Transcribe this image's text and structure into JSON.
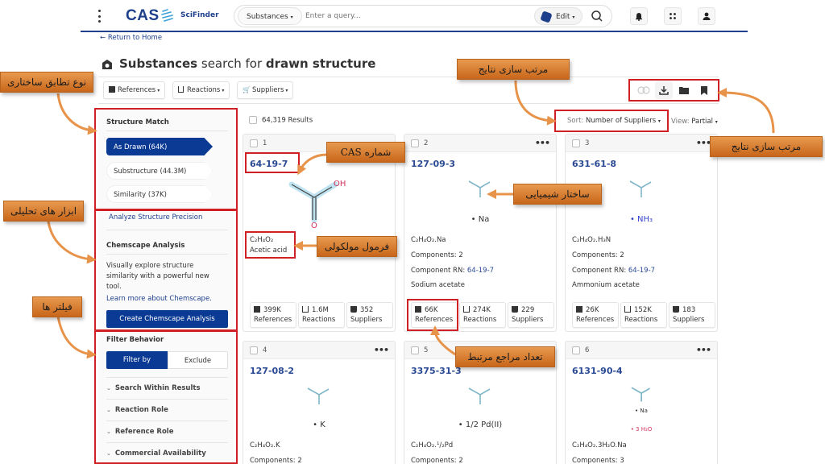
{
  "header": {
    "logo_text": "CAS",
    "logo_sub": "SciFinder",
    "search_type": "Substances",
    "search_placeholder": "Enter a query...",
    "edit_label": "Edit",
    "icons": [
      "menu-icon",
      "search-icon",
      "bell-icon",
      "apps-icon",
      "user-icon"
    ]
  },
  "nav": {
    "return_link": "← Return to Home"
  },
  "page": {
    "title_bold": "Substances",
    "title_mid": " search for ",
    "title_end": "drawn structure"
  },
  "toolbar": {
    "buttons": [
      {
        "label": "References",
        "icon": "book-icon"
      },
      {
        "label": "Reactions",
        "icon": "flask-icon"
      },
      {
        "label": "Suppliers",
        "icon": "cart-icon"
      }
    ],
    "actions": [
      "combine-icon",
      "download-icon",
      "folder-icon",
      "bookmark-icon"
    ]
  },
  "sidebar": {
    "structure_match": {
      "heading": "Structure Match",
      "items": [
        {
          "label": "As Drawn (64K)",
          "active": true
        },
        {
          "label": "Substructure (44.3M)",
          "active": false
        },
        {
          "label": "Similarity (37K)",
          "active": false
        }
      ]
    },
    "analyze_link": "Analyze Structure Precision",
    "chemscape": {
      "heading": "Chemscape Analysis",
      "description": "Visually explore structure similarity with a powerful new tool.",
      "learn_more": "Learn more about Chemscape.",
      "button": "Create Chemscape Analysis"
    },
    "filter_behavior": {
      "heading": "Filter Behavior",
      "options": [
        "Filter by",
        "Exclude"
      ],
      "selected": "Filter by"
    },
    "filters": [
      "Search Within Results",
      "Reaction Role",
      "Reference Role",
      "Commercial Availability"
    ]
  },
  "results": {
    "count_label": "64,319 Results",
    "sort_prefix": "Sort: ",
    "sort_value": "Number of Suppliers",
    "view_prefix": "View: ",
    "view_value": "Partial",
    "cards": [
      {
        "index": "1",
        "cas": "64-19-7",
        "salt": "",
        "formula": "C₂H₄O₂",
        "lines": [
          "Acetic acid"
        ],
        "references": "399K",
        "reactions": "1.6M",
        "suppliers": "352"
      },
      {
        "index": "2",
        "cas": "127-09-3",
        "salt": "• Na",
        "formula": "C₂H₄O₂.Na",
        "lines": [
          "Components: 2",
          "Component RN: ",
          "Sodium acetate"
        ],
        "component_rn": "64-19-7",
        "references": "66K",
        "reactions": "274K",
        "suppliers": "229"
      },
      {
        "index": "3",
        "cas": "631-61-8",
        "salt": "• NH₃",
        "formula": "C₂H₄O₂.H₃N",
        "lines": [
          "Components: 2",
          "Component RN: ",
          "Ammonium acetate"
        ],
        "component_rn": "64-19-7",
        "references": "26K",
        "reactions": "152K",
        "suppliers": "183"
      },
      {
        "index": "4",
        "cas": "127-08-2",
        "salt": "• K",
        "formula": "C₂H₄O₂.K",
        "lines": [
          "Components: 2"
        ]
      },
      {
        "index": "5",
        "cas": "3375-31-3",
        "salt": "• 1/2 Pd(II)",
        "formula": "C₂H₄O₂.¹/₂Pd",
        "lines": [
          "Components: 2"
        ]
      },
      {
        "index": "6",
        "cas": "6131-90-4",
        "salt": "• Na",
        "salt2": "• 3 H₂O",
        "formula": "C₂H₄O₂.3H₂O.Na",
        "lines": [
          "Components: 3"
        ]
      }
    ],
    "stat_labels": {
      "references": "References",
      "reactions": "Reactions",
      "suppliers": "Suppliers"
    },
    "structure_labels": {
      "oh": "OH",
      "o": "O"
    }
  },
  "annotations": {
    "structure_match_type": "نوع تطابق ساختاری",
    "analysis_tools": "ابزار های تحلیلی",
    "filters": "فیلتر ها",
    "sort_results_top": "مرتب سازی نتایج",
    "sort_results_right": "مرتب سازی نتایج",
    "cas_number": "شماره CAS",
    "chemical_structure": "ساختار شیمیایی",
    "molecular_formula": "فرمول مولکولی",
    "related_references": "تعداد مراجع مرتبط"
  },
  "colors": {
    "brand": "#1d3f8c",
    "active": "#0b3a94",
    "highlight": "#d01f25",
    "callout": "#e08a3c"
  }
}
